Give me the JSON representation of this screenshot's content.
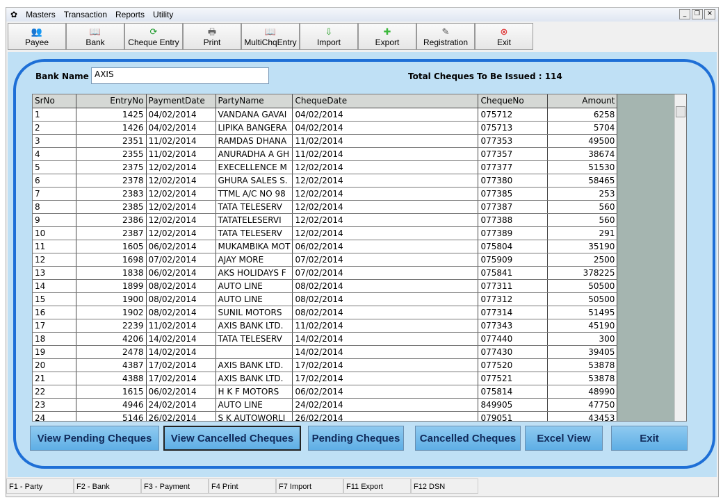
{
  "menu": [
    "Masters",
    "Transaction",
    "Reports",
    "Utility"
  ],
  "window_controls": [
    "_",
    "❐",
    "✕"
  ],
  "toolbar": [
    {
      "label": "Payee",
      "icon": "people-icon",
      "glyph": "👥",
      "color": "#c9842a"
    },
    {
      "label": "Bank",
      "icon": "book-icon",
      "glyph": "📖",
      "color": "#8a3b2a"
    },
    {
      "label": "Cheque Entry",
      "icon": "refresh-icon",
      "glyph": "⟳",
      "color": "#1c9a2a"
    },
    {
      "label": "Print",
      "icon": "printer-icon",
      "glyph": "🖶",
      "color": "#666"
    },
    {
      "label": "MultiChqEntry",
      "icon": "book-icon",
      "glyph": "📖",
      "color": "#8a3b2a"
    },
    {
      "label": "Import",
      "icon": "import-icon",
      "glyph": "⇩",
      "color": "#2aa02a"
    },
    {
      "label": "Export",
      "icon": "plus-icon",
      "glyph": "✚",
      "color": "#3cb83c"
    },
    {
      "label": "Registration",
      "icon": "register-icon",
      "glyph": "✎",
      "color": "#555"
    },
    {
      "label": "Exit",
      "icon": "close-circle-icon",
      "glyph": "⊗",
      "color": "#d22"
    }
  ],
  "bank": {
    "label": "Bank Name",
    "value": "AXIS"
  },
  "total": "Total Cheques To Be Issued : 114",
  "columns": [
    "SrNo",
    "EntryNo",
    "PaymentDate",
    "PartyName",
    "ChequeDate",
    "ChequeNo",
    "Amount"
  ],
  "rows": [
    [
      "1",
      "1425",
      "04/02/2014",
      "VANDANA GAVAI",
      "04/02/2014",
      "075712",
      "6258"
    ],
    [
      "2",
      "1426",
      "04/02/2014",
      "LIPIKA BANGERA",
      "04/02/2014",
      "075713",
      "5704"
    ],
    [
      "3",
      "2351",
      "11/02/2014",
      "RAMDAS DHANA",
      "11/02/2014",
      "077353",
      "49500"
    ],
    [
      "4",
      "2355",
      "11/02/2014",
      "ANURADHA A GH",
      "11/02/2014",
      "077357",
      "38674"
    ],
    [
      "5",
      "2375",
      "12/02/2014",
      "EXECELLENCE M",
      "12/02/2014",
      "077377",
      "51530"
    ],
    [
      "6",
      "2378",
      "12/02/2014",
      "GHURA SALES S.",
      "12/02/2014",
      "077380",
      "58465"
    ],
    [
      "7",
      "2383",
      "12/02/2014",
      "TTML A/C NO 98",
      "12/02/2014",
      "077385",
      "253"
    ],
    [
      "8",
      "2385",
      "12/02/2014",
      "TATA TELESERV",
      "12/02/2014",
      "077387",
      "560"
    ],
    [
      "9",
      "2386",
      "12/02/2014",
      "TATATELESERVI",
      "12/02/2014",
      "077388",
      "560"
    ],
    [
      "10",
      "2387",
      "12/02/2014",
      "TATA TELESERV",
      "12/02/2014",
      "077389",
      "291"
    ],
    [
      "11",
      "1605",
      "06/02/2014",
      "MUKAMBIKA MOT",
      "06/02/2014",
      "075804",
      "35190"
    ],
    [
      "12",
      "1698",
      "07/02/2014",
      "AJAY MORE",
      "07/02/2014",
      "075909",
      "2500"
    ],
    [
      "13",
      "1838",
      "06/02/2014",
      "AKS HOLIDAYS F",
      "07/02/2014",
      "075841",
      "378225"
    ],
    [
      "14",
      "1899",
      "08/02/2014",
      "AUTO LINE",
      "08/02/2014",
      "077311",
      "50500"
    ],
    [
      "15",
      "1900",
      "08/02/2014",
      "AUTO LINE",
      "08/02/2014",
      "077312",
      "50500"
    ],
    [
      "16",
      "1902",
      "08/02/2014",
      "SUNIL MOTORS",
      "08/02/2014",
      "077314",
      "51495"
    ],
    [
      "17",
      "2239",
      "11/02/2014",
      "AXIS BANK LTD.",
      "11/02/2014",
      "077343",
      "45190"
    ],
    [
      "18",
      "4206",
      "14/02/2014",
      "TATA TELESERV",
      "14/02/2014",
      "077440",
      "300"
    ],
    [
      "19",
      "2478",
      "14/02/2014",
      "",
      "14/02/2014",
      "077430",
      "39405"
    ],
    [
      "20",
      "4387",
      "17/02/2014",
      "AXIS BANK LTD.",
      "17/02/2014",
      "077520",
      "53878"
    ],
    [
      "21",
      "4388",
      "17/02/2014",
      "AXIS BANK LTD.",
      "17/02/2014",
      "077521",
      "53878"
    ],
    [
      "22",
      "1615",
      "06/02/2014",
      "H K F MOTORS",
      "06/02/2014",
      "075814",
      "48990"
    ],
    [
      "23",
      "4946",
      "24/02/2014",
      "AUTO LINE",
      "24/02/2014",
      "849905",
      "47750"
    ],
    [
      "24",
      "5146",
      "26/02/2014",
      "S K AUTOWORLI",
      "26/02/2014",
      "079051",
      "43453"
    ]
  ],
  "buttons": [
    {
      "label": "View Pending Cheques",
      "selected": false
    },
    {
      "label": "View Cancelled Cheques",
      "selected": true
    },
    {
      "label": "Pending Cheques",
      "selected": false
    },
    {
      "label": "Cancelled Cheques",
      "selected": false
    },
    {
      "label": "Excel View",
      "selected": false
    },
    {
      "label": "Exit",
      "selected": false
    }
  ],
  "status": [
    "F1 - Party",
    "F2 - Bank",
    "F3 - Payment",
    "F4 Print",
    "F7 Import",
    "F11 Export",
    "F12 DSN"
  ]
}
